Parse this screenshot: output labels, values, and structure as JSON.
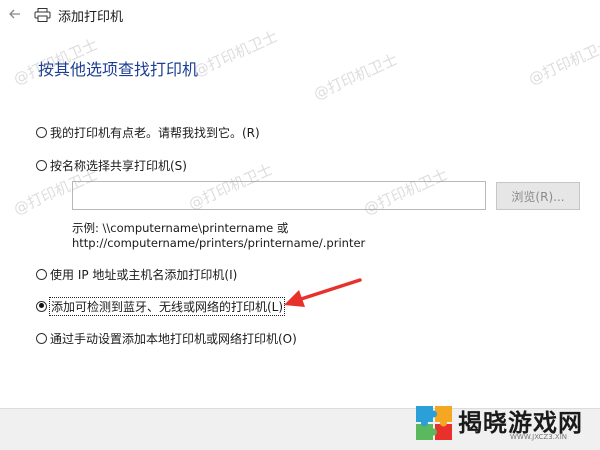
{
  "window": {
    "title": "添加打印机",
    "back_icon": "arrow-left-icon",
    "app_icon": "printer-icon"
  },
  "heading": "按其他选项查找打印机",
  "options": [
    {
      "label": "我的打印机有点老。请帮我找到它。(R)",
      "checked": false
    },
    {
      "label": "按名称选择共享打印机(S)",
      "checked": false
    },
    {
      "label": "使用 IP 地址或主机名添加打印机(I)",
      "checked": false
    },
    {
      "label": "添加可检测到蓝牙、无线或网络的打印机(L)",
      "checked": true
    },
    {
      "label": "通过手动设置添加本地打印机或网络打印机(O)",
      "checked": false
    }
  ],
  "shared_printer": {
    "input_value": "",
    "browse_label": "浏览(R)...",
    "example_line1": "示例: \\\\computername\\printername 或",
    "example_line2": "http://computername/printers/printername/.printer"
  },
  "watermark": "@打印机卫士",
  "brand": {
    "name": "揭晓游戏网",
    "url": "WWW.JXCZ3.XIN"
  },
  "colors": {
    "heading": "#1c3f95",
    "arrow": "#e8312b",
    "footer": "#f0f0f0"
  }
}
